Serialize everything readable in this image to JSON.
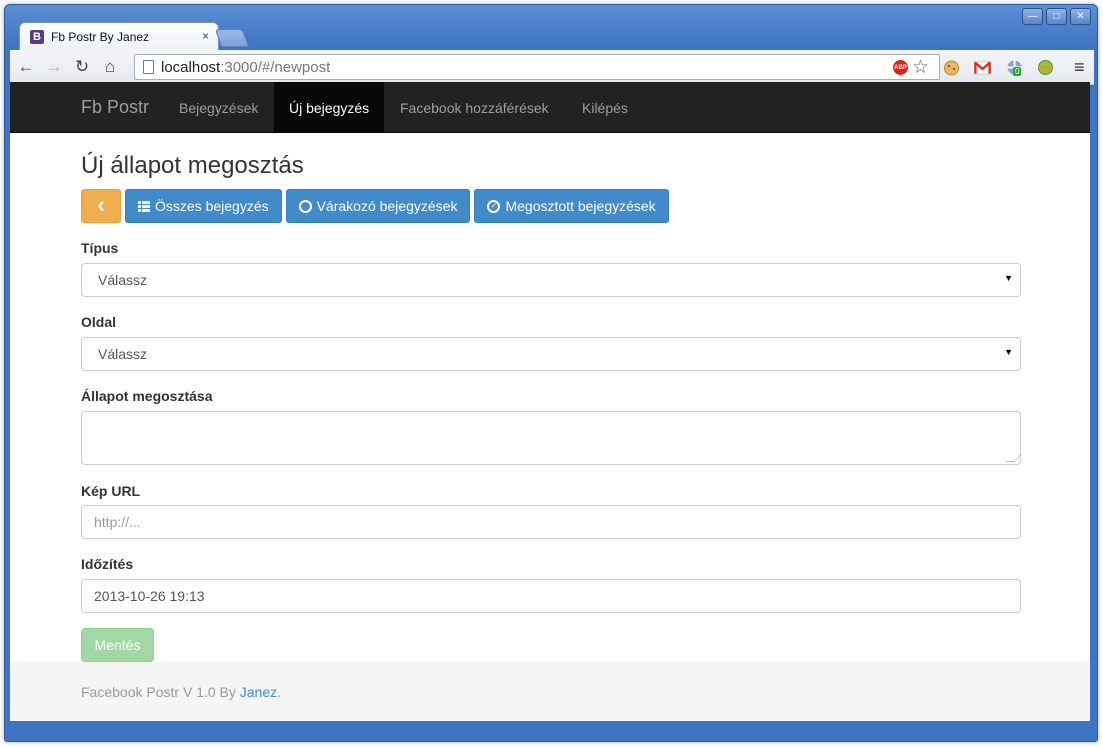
{
  "browser": {
    "tab_title": "Fb Postr By Janez",
    "tab_favicon": "B",
    "tab_close": "×",
    "url_host": "localhost",
    "url_rest": ":3000/#/newpost",
    "window_controls": {
      "minimize": "—",
      "maximize": "□",
      "close": "✕"
    },
    "nav": {
      "back": "←",
      "forward": "→",
      "reload": "↻",
      "home": "⌂"
    },
    "abp_label": "ABP",
    "star": "☆",
    "menu": "≡",
    "extensions": [
      "cookie-icon",
      "gmail-icon",
      "extension-badge-icon",
      "green-sphere-icon"
    ],
    "ext_badge": "0"
  },
  "navbar": {
    "brand": "Fb Postr",
    "links": [
      {
        "label": "Bejegyzések"
      },
      {
        "label": "Új bejegyzés",
        "active": true
      },
      {
        "label": "Facebook hozzáférések"
      },
      {
        "label": "Kilépés"
      }
    ]
  },
  "page": {
    "title": "Új állapot megosztás",
    "buttons": {
      "back_icon": "‹",
      "all": "Összes bejegyzés",
      "pending": "Várakozó bejegyzések",
      "shared": "Megosztott bejegyzések",
      "clock_icon": "◷",
      "check_icon": "✓"
    },
    "form": {
      "type_label": "Típus",
      "type_value": "Válassz",
      "page_label": "Oldal",
      "page_value": "Válassz",
      "status_label": "Állapot megosztása",
      "status_value": "",
      "image_label": "Kép URL",
      "image_placeholder": "http://...",
      "schedule_label": "Időzítés",
      "schedule_value": "2013-10-26 19:13",
      "caret": "▼",
      "save": "Mentés"
    }
  },
  "footer": {
    "text": "Facebook Postr V 1.0 By ",
    "author": "Janez",
    "suffix": "."
  },
  "colors": {
    "navbar_bg": "#222222",
    "primary": "#428bca",
    "warning": "#f0ad4e",
    "success_disabled": "#a3d7a3"
  }
}
